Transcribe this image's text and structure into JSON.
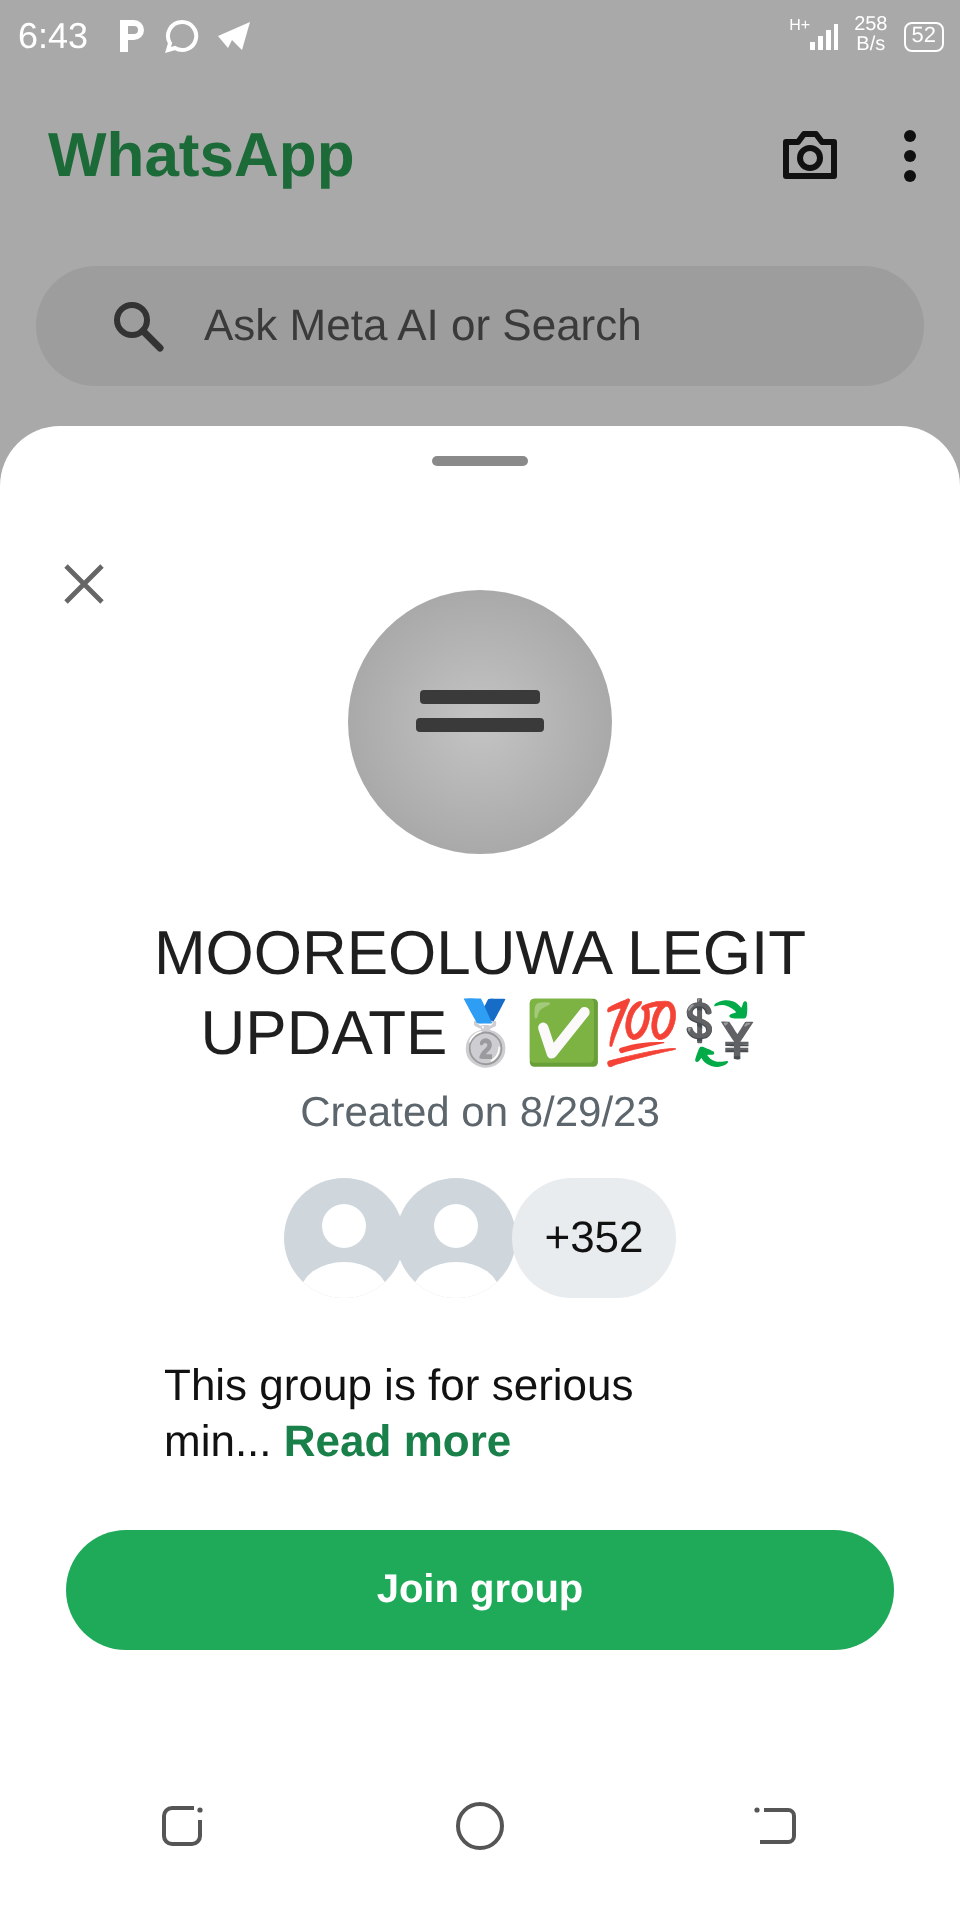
{
  "status_bar": {
    "time": "6:43",
    "network_type": "H+",
    "speed_value": "258",
    "speed_unit": "B/s",
    "battery": "52"
  },
  "app_bar": {
    "title": "WhatsApp"
  },
  "search": {
    "placeholder": "Ask Meta AI or Search"
  },
  "group_sheet": {
    "name": "MOOREOLUWA LEGIT UPDATE🥈✅💯💱",
    "created": "Created on 8/29/23",
    "members_extra": "+352",
    "description": "This group is for serious min...",
    "read_more": "Read more",
    "join_button": "Join group"
  }
}
